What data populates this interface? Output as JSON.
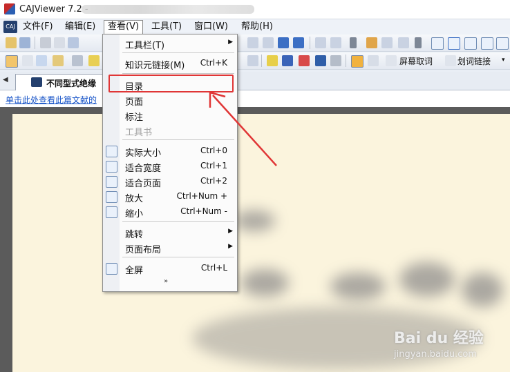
{
  "window": {
    "title": "CAJViewer 7.2 -"
  },
  "menubar": {
    "logo": "CAJ",
    "items": [
      {
        "label": "文件(F)"
      },
      {
        "label": "编辑(E)"
      },
      {
        "label": "查看(V)"
      },
      {
        "label": "工具(T)"
      },
      {
        "label": "窗口(W)"
      },
      {
        "label": "帮助(H)"
      }
    ]
  },
  "toolbar": {
    "screen_capture_label": "屏幕取词",
    "word_link_label": "划词链接"
  },
  "tab": {
    "label": "不同型式绝缘"
  },
  "linkbar": {
    "text": "单击此处查看此篇文献的"
  },
  "view_menu": {
    "items": [
      {
        "label": "工具栏(T)",
        "shortcut": "",
        "submenu": true,
        "disabled": false,
        "icon": ""
      },
      {
        "label": "知识元链接(M)",
        "shortcut": "Ctrl+K",
        "submenu": false,
        "disabled": false,
        "icon": ""
      },
      {
        "label": "目录",
        "shortcut": "",
        "submenu": false,
        "disabled": false,
        "icon": ""
      },
      {
        "label": "页面",
        "shortcut": "",
        "submenu": false,
        "disabled": false,
        "icon": ""
      },
      {
        "label": "标注",
        "shortcut": "",
        "submenu": false,
        "disabled": false,
        "icon": ""
      },
      {
        "label": "工具书",
        "shortcut": "",
        "submenu": false,
        "disabled": true,
        "icon": ""
      },
      {
        "label": "实际大小",
        "shortcut": "Ctrl+0",
        "submenu": false,
        "disabled": false,
        "icon": "page-icon"
      },
      {
        "label": "适合宽度",
        "shortcut": "Ctrl+1",
        "submenu": false,
        "disabled": false,
        "icon": "fit-width-icon"
      },
      {
        "label": "适合页面",
        "shortcut": "Ctrl+2",
        "submenu": false,
        "disabled": false,
        "icon": "fit-page-icon"
      },
      {
        "label": "放大",
        "shortcut": "Ctrl+Num +",
        "submenu": false,
        "disabled": false,
        "icon": "zoom-in-icon"
      },
      {
        "label": "缩小",
        "shortcut": "Ctrl+Num -",
        "submenu": false,
        "disabled": false,
        "icon": "zoom-out-icon"
      },
      {
        "label": "跳转",
        "shortcut": "",
        "submenu": true,
        "disabled": false,
        "icon": ""
      },
      {
        "label": "页面布局",
        "shortcut": "",
        "submenu": true,
        "disabled": false,
        "icon": ""
      },
      {
        "label": "全屏",
        "shortcut": "Ctrl+L",
        "submenu": false,
        "disabled": false,
        "icon": "fullscreen-icon"
      }
    ],
    "more": "»"
  },
  "watermark": {
    "brand": "Bai du 经验",
    "url": "jingyan.baidu.com"
  }
}
